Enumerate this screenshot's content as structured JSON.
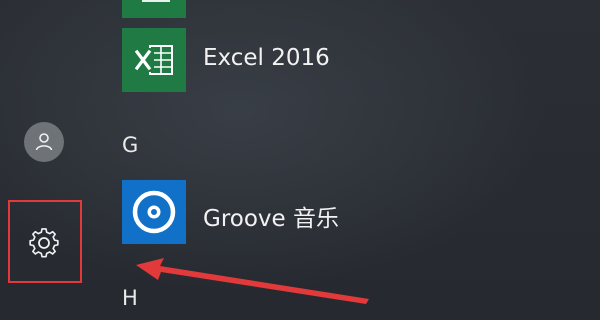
{
  "colors": {
    "background": "#2b2f35",
    "excel_tile": "#1f7a43",
    "groove_tile": "#1171c9",
    "annotation_red": "#e23a3a",
    "text": "#f2f2f2"
  },
  "left_rail": {
    "avatar_icon": "user-icon",
    "settings_icon": "gear-icon"
  },
  "apps": {
    "partial_top": {
      "icon": "office-app-icon"
    },
    "excel": {
      "label": "Excel 2016",
      "icon": "excel-icon"
    },
    "groove": {
      "label": "Groove 音乐",
      "icon": "groove-music-icon"
    }
  },
  "sections": {
    "g": "G",
    "h": "H"
  },
  "annotations": {
    "highlight": "red-box-settings",
    "arrow": "red-arrow-pointing-left"
  }
}
